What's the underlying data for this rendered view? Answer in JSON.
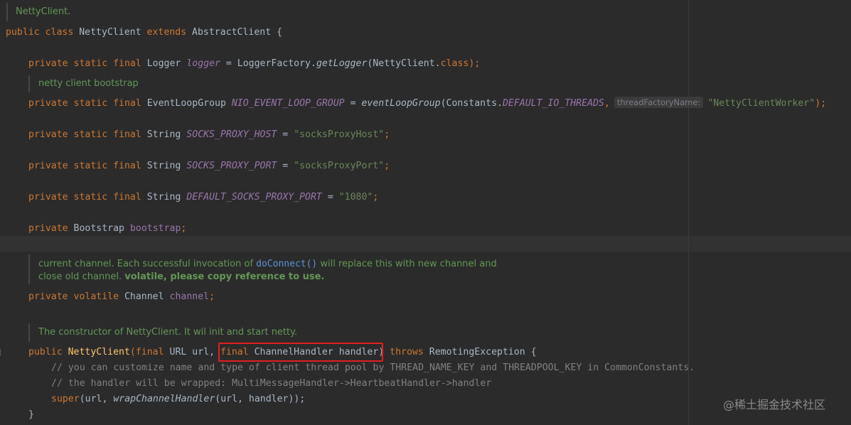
{
  "doc_comments": {
    "class_doc": "NettyClient.",
    "bootstrap_doc": "netty client bootstrap",
    "channel_doc_line1_a": "current channel. Each successful invocation of ",
    "channel_doc_line1_link": "doConnect()",
    "channel_doc_line1_b": " will replace this with new channel and",
    "channel_doc_line2_a": "close old channel. ",
    "channel_doc_line2_bold": "volatile, please copy reference to use.",
    "ctor_doc": "The constructor of NettyClient. It wil init and start netty."
  },
  "code": {
    "class_decl": {
      "kw1": "public class ",
      "name": "NettyClient ",
      "kw2": "extends ",
      "parent": "AbstractClient {"
    },
    "logger": {
      "kw": "private static final ",
      "type": "Logger ",
      "field": "logger",
      "eq": " = LoggerFactory.",
      "call": "getLogger",
      "arg": "(NettyClient.",
      "kwclass": "class",
      "end": ");"
    },
    "nio": {
      "kw": "private static final ",
      "type": "EventLoopGroup ",
      "field": "NIO_EVENT_LOOP_GROUP",
      "eq": " = ",
      "call": "eventLoopGroup",
      "arg": "(Constants.",
      "const": "DEFAULT_IO_THREADS",
      "comma": ",",
      "hint": "threadFactoryName:",
      "str": "\"NettyClientWorker\"",
      "end": ");"
    },
    "socks_host": {
      "kw": "private static final ",
      "type": "String ",
      "field": "SOCKS_PROXY_HOST",
      "eq": " = ",
      "str": "\"socksProxyHost\"",
      "end": ";"
    },
    "socks_port": {
      "kw": "private static final ",
      "type": "String ",
      "field": "SOCKS_PROXY_PORT",
      "eq": " = ",
      "str": "\"socksProxyPort\"",
      "end": ";"
    },
    "default_port": {
      "kw": "private static final ",
      "type": "String ",
      "field": "DEFAULT_SOCKS_PROXY_PORT",
      "eq": " = ",
      "str": "\"1080\"",
      "end": ";"
    },
    "bootstrap": {
      "kw": "private ",
      "type": "Bootstrap ",
      "field": "bootstrap",
      "end": ";"
    },
    "channel": {
      "kw": "private volatile ",
      "type": "Channel ",
      "field": "channel",
      "end": ";"
    },
    "ctor": {
      "kw": "public ",
      "name": "NettyClient",
      "p1kw": "(final ",
      "p1": "URL url, ",
      "p2kw": "final ",
      "p2": "ChannelHandler handler",
      "close": ") ",
      "throws": "throws ",
      "exc": "RemotingException {"
    },
    "comment1": "// you can customize name and type of client thread pool by THREAD_NAME_KEY and THREADPOOL_KEY in CommonConstants.",
    "comment2": "// the handler will be wrapped: MultiMessageHandler->HeartbeatHandler->handler",
    "super_call": {
      "kw": "super",
      "a": "(url, ",
      "call": "wrapChannelHandler",
      "b": "(url, handler));"
    },
    "close_brace": "}"
  },
  "watermark": "@稀土掘金技术社区"
}
